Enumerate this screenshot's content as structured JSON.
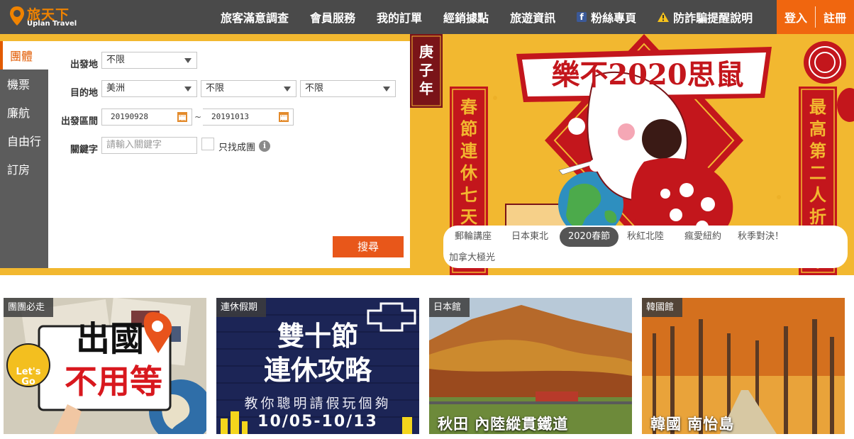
{
  "brand": {
    "name_cn": "旅天下",
    "name_en": "Uplan Travel"
  },
  "nav": {
    "items": [
      "旅客滿意調查",
      "會員服務",
      "我的訂單",
      "經銷據點",
      "旅遊資訊"
    ],
    "fans": "粉絲專頁",
    "scam": "防詐騙提醒說明",
    "login": "登入",
    "register": "註冊"
  },
  "search": {
    "tabs": [
      "團體",
      "機票",
      "廉航",
      "自由行",
      "訂房"
    ],
    "labels": {
      "depart": "出發地",
      "dest": "目的地",
      "period": "出發區間",
      "keyword": "關鍵字"
    },
    "depart_value": "不限",
    "dest_values": [
      "美洲",
      "不限",
      "不限"
    ],
    "date_from": "20190928",
    "date_to": "20191013",
    "date_sep": "~",
    "keyword_placeholder": "請輸入關鍵字",
    "only_formed": "只找成團",
    "info": "i",
    "button": "搜尋"
  },
  "banner": {
    "year_label": [
      "庚",
      "子",
      "年"
    ],
    "headline": "樂不2020思鼠",
    "left_couplet": "春節連休七天",
    "right_couplet": "最高第二人折六千",
    "tags": [
      "郵輪講座",
      "日本東北",
      "2020春節",
      "秋紅北陸",
      "瘋愛紐約",
      "秋季對決！",
      "加拿大極光"
    ],
    "active_tag": "2020春節"
  },
  "promos": [
    {
      "tag": "團團必走",
      "title_lines": [
        "出國",
        "不用等"
      ],
      "badge": "Let's Go"
    },
    {
      "tag": "連休假期",
      "title_lines": [
        "雙十節",
        "連休攻略"
      ],
      "sub": "教你聰明請假玩個夠",
      "date": "10/05-10/13"
    },
    {
      "tag": "日本館",
      "caption": "秋田 內陸縱貫鐵道"
    },
    {
      "tag": "韓國館",
      "caption": "韓國 南怡島"
    }
  ],
  "colors": {
    "accent": "#f0660f",
    "nav_bg": "#4a4a4a",
    "banner_gold": "#f2b830",
    "banner_red": "#c3161c"
  }
}
